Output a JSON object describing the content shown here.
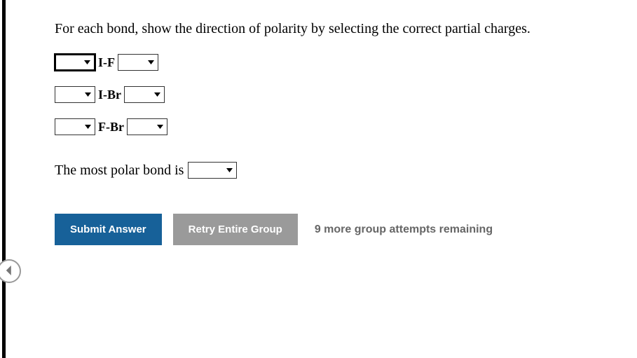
{
  "question": "For each bond, show the direction of polarity by selecting the correct partial charges.",
  "bonds": [
    {
      "label": "I-F",
      "left_value": "",
      "right_value": "",
      "left_focused": true
    },
    {
      "label": "I-Br",
      "left_value": "",
      "right_value": "",
      "left_focused": false
    },
    {
      "label": "F-Br",
      "left_value": "",
      "right_value": "",
      "left_focused": false
    }
  ],
  "polar_prompt": "The most polar bond is",
  "polar_value": "",
  "buttons": {
    "submit": "Submit Answer",
    "retry": "Retry Entire Group"
  },
  "attempts_text": "9 more group attempts remaining"
}
